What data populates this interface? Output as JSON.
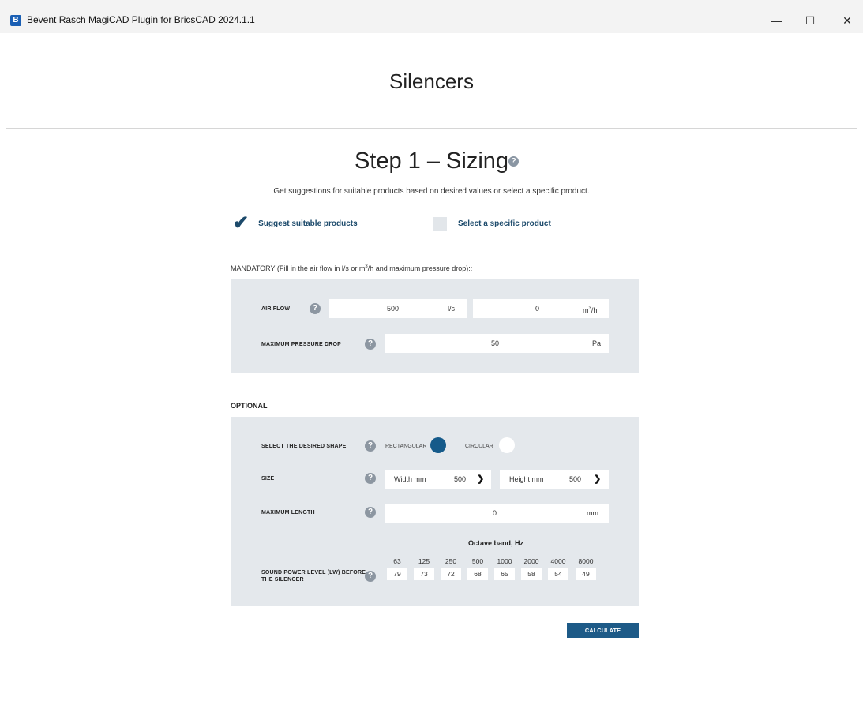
{
  "window": {
    "title": "Bevent Rasch MagiCAD Plugin for BricsCAD 2024.1.1",
    "app_icon": "app-logo-icon",
    "controls": {
      "minimize": "—",
      "maximize": "☐",
      "close": "✕"
    }
  },
  "page": {
    "title": "Silencers"
  },
  "step": {
    "title": "Step 1 – Sizing",
    "subtitle": "Get suggestions for suitable products based on desired values or select a specific product."
  },
  "mode": {
    "suggest_label": "Suggest suitable products",
    "suggest_checked": true,
    "select_label": "Select a specific product",
    "select_checked": false
  },
  "mandatory": {
    "label_prefix": "MANDATORY (Fill in the air flow in l/s or m",
    "label_sup": "3",
    "label_suffix": "/h and maximum pressure drop)::",
    "air_flow": {
      "label": "AIR FLOW",
      "ls_value": "500",
      "ls_unit": "l/s",
      "m3h_value": "0",
      "m3h_unit_base": "m",
      "m3h_unit_sup": "3",
      "m3h_unit_tail": "/h"
    },
    "pressure_drop": {
      "label": "MAXIMUM PRESSURE DROP",
      "value": "50",
      "unit": "Pa"
    }
  },
  "optional": {
    "label": "OPTIONAL",
    "shape": {
      "label": "SELECT THE DESIRED SHAPE",
      "rect_label": "RECTANGULAR",
      "rect_selected": true,
      "circ_label": "CIRCULAR",
      "circ_selected": false
    },
    "size": {
      "label": "SIZE",
      "width_label": "Width mm",
      "width_value": "500",
      "height_label": "Height mm",
      "height_value": "500"
    },
    "max_length": {
      "label": "MAXIMUM LENGTH",
      "value": "0",
      "unit": "mm"
    },
    "sound": {
      "label_line1": "SOUND POWER LEVEL (LW) BEFORE",
      "label_line2": "THE SILENCER",
      "octave_title": "Octave band, Hz",
      "frequencies": [
        "63",
        "125",
        "250",
        "500",
        "1000",
        "2000",
        "4000",
        "8000"
      ],
      "values": [
        "79",
        "73",
        "72",
        "68",
        "65",
        "58",
        "54",
        "49"
      ]
    }
  },
  "actions": {
    "calculate": "CALCULATE"
  },
  "colors": {
    "accent": "#1d5a87",
    "panel": "#e4e8ec",
    "radio_selected": "#155a8a"
  }
}
